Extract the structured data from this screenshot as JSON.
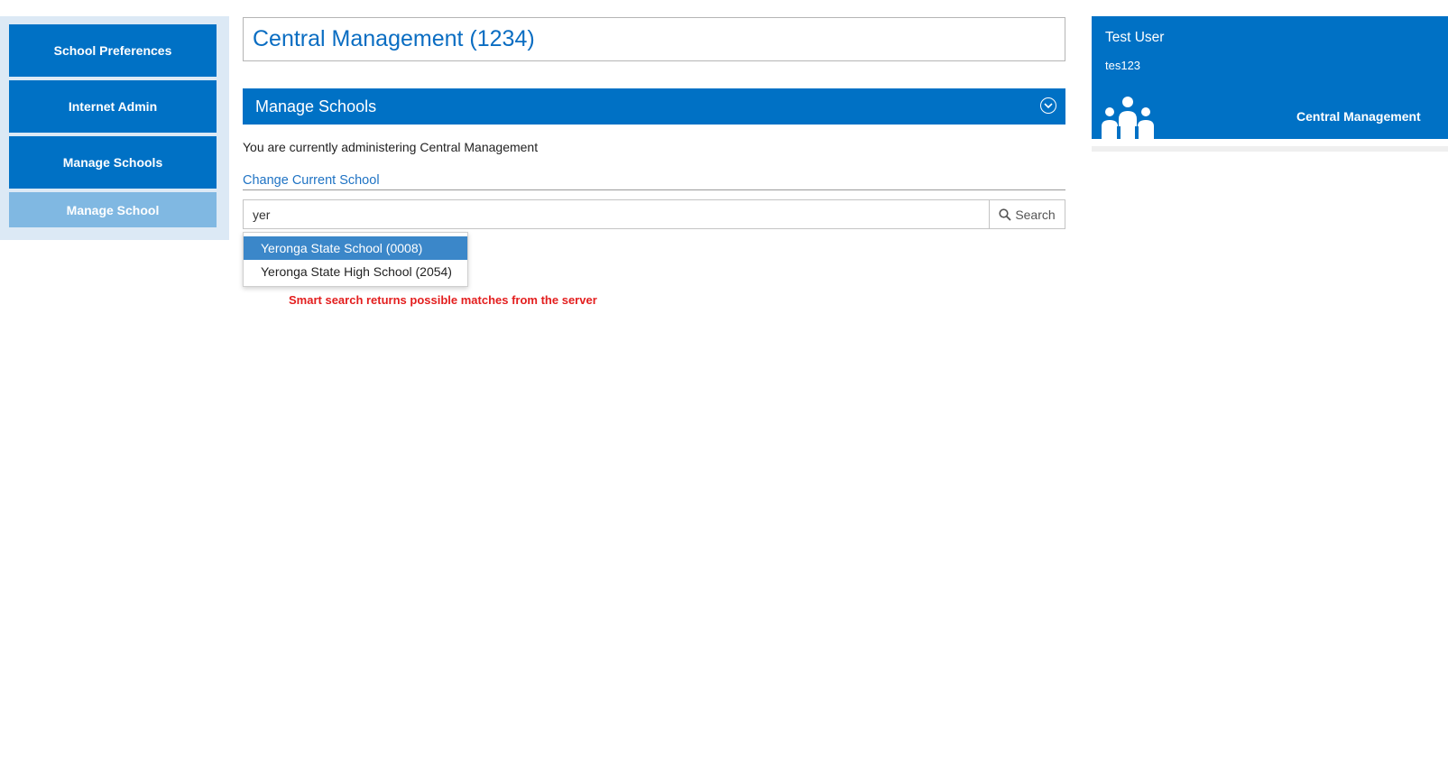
{
  "sidebar": {
    "items": [
      {
        "label": "School Preferences"
      },
      {
        "label": "Internet Admin"
      },
      {
        "label": "Manage Schools"
      },
      {
        "label": "Manage School"
      }
    ]
  },
  "header": {
    "title": "Central Management (1234)"
  },
  "section": {
    "title": "Manage Schools",
    "admin_text": "You are currently administering Central Management",
    "change_link": "Change Current School"
  },
  "search": {
    "value": "yer",
    "button_label": "Search",
    "icon": "search-icon",
    "suggestions": [
      {
        "label": "Yeronga State School (0008)",
        "highlighted": true
      },
      {
        "label": "Yeronga State High School (2054)",
        "highlighted": false
      }
    ]
  },
  "annotation": "Smart search returns possible matches from the server",
  "user": {
    "name": "Test User",
    "id": "tes123",
    "organisation": "Central Management",
    "icon": "people-icon"
  },
  "colors": {
    "brand_blue": "#0071c5",
    "sidebar_bg": "#dce9f5",
    "sub_item_bg": "#80b8e2",
    "highlight": "#3b87c9",
    "annotation_red": "#e31e1e",
    "link_blue": "#1f73c4"
  }
}
